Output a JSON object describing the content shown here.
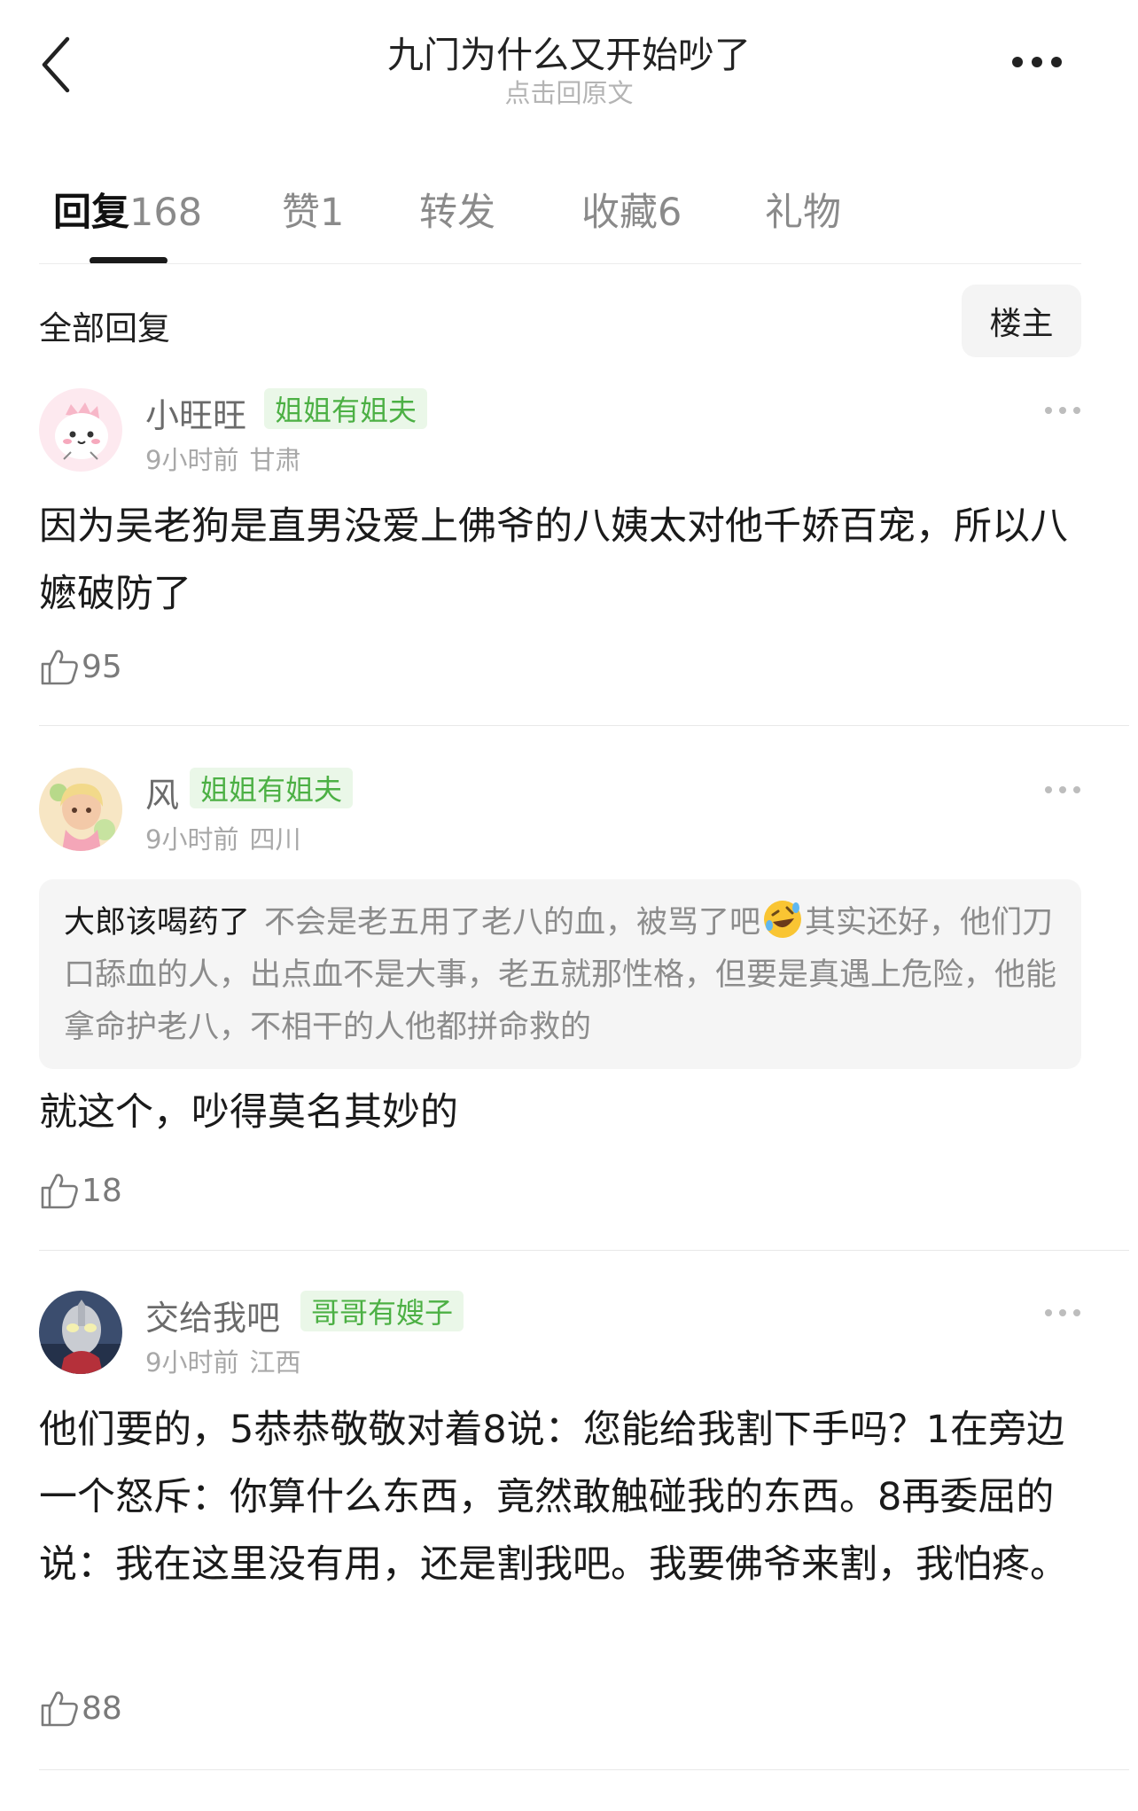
{
  "header": {
    "title": "九门为什么又开始吵了",
    "subtitle": "点击回原文"
  },
  "tabs": [
    {
      "label": "回复",
      "count": "168",
      "active": true
    },
    {
      "label": "赞",
      "count": "1",
      "active": false
    },
    {
      "label": "转发",
      "count": "",
      "active": false
    },
    {
      "label": "收藏",
      "count": "6",
      "active": false
    },
    {
      "label": "礼物",
      "count": "",
      "active": false
    }
  ],
  "section": {
    "title": "全部回复",
    "filter_label": "楼主"
  },
  "comments": [
    {
      "username": "小旺旺",
      "badge": "姐姐有姐夫",
      "time": "9小时前",
      "location": "甘肃",
      "text": "因为吴老狗是直男没爱上佛爷的八姨太对他千娇百宠，所以八嬷破防了",
      "likes": "95",
      "avatar_icon": "dinosaur-avatar"
    },
    {
      "username": "风",
      "badge": "姐姐有姐夫",
      "time": "9小时前",
      "location": "四川",
      "quote": {
        "name": "大郎该喝药了",
        "text_before_emoji": "不会是老五用了老八的血，被骂了吧",
        "emoji": "rofl-emoji",
        "text_after_emoji": "其实还好，他们刀口舔血的人，出点血不是大事，老五就那性格，但要是真遇上危险，他能拿命护老八，不相干的人他都拼命救的"
      },
      "text": "就这个，吵得莫名其妙的",
      "likes": "18",
      "avatar_icon": "anime-girl-avatar"
    },
    {
      "username": "交给我吧",
      "badge": "哥哥有嫂子",
      "time": "9小时前",
      "location": "江西",
      "text": "他们要的，5恭恭敬敬对着8说：您能给我割下手吗？1在旁边一个怒斥：你算什么东西，竟然敢触碰我的东西。8再委屈的说：我在这里没有用，还是割我吧。我要佛爷来割，我怕疼。",
      "likes": "88",
      "avatar_icon": "ultraman-avatar"
    }
  ],
  "colors": {
    "badge_bg": "#eaf7e8",
    "badge_text": "#4cb044",
    "quote_bg": "#f5f5f5",
    "divider": "#e8e8e8"
  }
}
